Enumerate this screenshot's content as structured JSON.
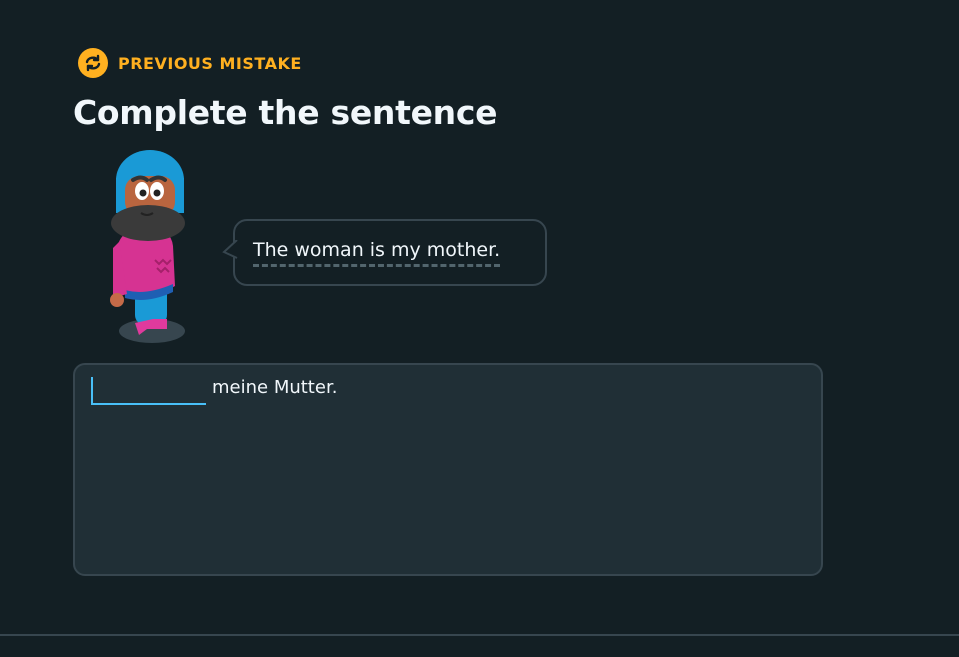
{
  "header": {
    "badge_icon": "repeat-arrows-icon",
    "badge_label": "PREVIOUS MISTAKE",
    "title": "Complete the sentence"
  },
  "prompt": {
    "sentence": "The woman is my mother."
  },
  "answer": {
    "blank_value": "",
    "rest_text": "meine Mutter."
  },
  "colors": {
    "accent": "#ffb020",
    "input_focus": "#49c0f8",
    "background": "#131f24"
  }
}
